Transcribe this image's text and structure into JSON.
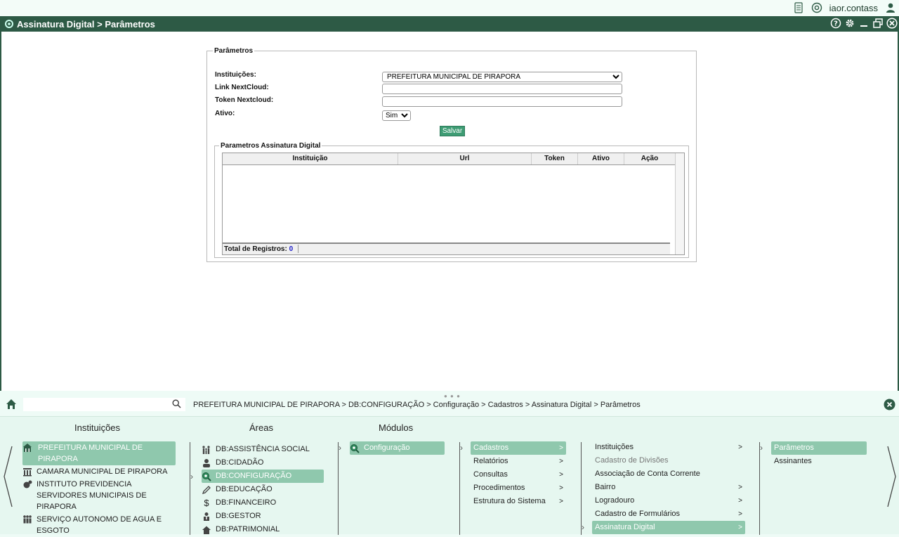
{
  "topbar": {
    "user": "iaor.contass",
    "icons": [
      "document-icon",
      "support-icon",
      "user-icon"
    ]
  },
  "window": {
    "title": "Assinatura Digital > Parâmetros",
    "tools": [
      "help-icon",
      "gear-icon",
      "minimize-icon",
      "restore-icon",
      "close-icon"
    ]
  },
  "form": {
    "legend": "Parâmetros",
    "labels": {
      "instituicoes": "Instituições:",
      "link": "Link NextCloud:",
      "token": "Token Nextcloud:",
      "ativo": "Ativo:"
    },
    "instituicao_value": "PREFEITURA MUNICIPAL DE PIRAPORA",
    "link_value": "",
    "token_value": "",
    "ativo_value": "Sim",
    "save_label": "Salvar"
  },
  "grid": {
    "legend": "Parametros Assinatura Digital",
    "columns": [
      "Instituição",
      "Url",
      "Token",
      "Ativo",
      "Ação"
    ],
    "rows": [],
    "total_label": "Total de Registros:",
    "total_value": "0"
  },
  "nav": {
    "search_value": "",
    "breadcrumb": "PREFEITURA MUNICIPAL DE PIRAPORA > DB:CONFIGURAÇÃO > Configuração > Cadastros > Assinatura Digital > Parâmetros",
    "titles": {
      "instituicoes": "Instituições",
      "areas": "Áreas",
      "modulos": "Módulos"
    },
    "instituicoes": [
      {
        "label": "PREFEITURA MUNICIPAL DE PIRAPORA",
        "icon": "building-icon"
      },
      {
        "label": "CAMARA MUNICIPAL DE PIRAPORA",
        "icon": "chamber-icon"
      },
      {
        "label": "INSTITUTO PREVIDENCIA SERVIDORES MUNICIPAIS DE PIRAPORA",
        "icon": "institute-icon"
      },
      {
        "label": "SERVIÇO AUTONOMO DE AGUA E ESGOTO",
        "icon": "people-icon"
      }
    ],
    "areas": [
      {
        "label": "DB:ASSISTÊNCIA SOCIAL",
        "icon": "family-icon"
      },
      {
        "label": "DB:CIDADÃO",
        "icon": "citizen-icon"
      },
      {
        "label": "DB:CONFIGURAÇÃO",
        "icon": "config-icon"
      },
      {
        "label": "DB:EDUCAÇÃO",
        "icon": "pencil-icon"
      },
      {
        "label": "DB:FINANCEIRO",
        "icon": "dollar-icon"
      },
      {
        "label": "DB:GESTOR",
        "icon": "manager-icon"
      },
      {
        "label": "DB:PATRIMONIAL",
        "icon": "house-icon"
      }
    ],
    "modulos": [
      {
        "label": "Configuração",
        "icon": "config-icon"
      }
    ],
    "menu1": [
      {
        "label": "Cadastros",
        "arrow": ">"
      },
      {
        "label": "Relatórios",
        "arrow": ">"
      },
      {
        "label": "Consultas",
        "arrow": ">"
      },
      {
        "label": "Procedimentos",
        "arrow": ">"
      },
      {
        "label": "Estrutura do Sistema",
        "arrow": ">"
      }
    ],
    "menu2": [
      {
        "label": "Instituições",
        "arrow": ">"
      },
      {
        "label": "Cadastro de Divisões",
        "arrow": ""
      },
      {
        "label": "Associação de Conta Corrente",
        "arrow": ""
      },
      {
        "label": "Bairro",
        "arrow": ">"
      },
      {
        "label": "Logradouro",
        "arrow": ">"
      },
      {
        "label": "Cadastro de Formulários",
        "arrow": ">"
      },
      {
        "label": "Assinatura Digital",
        "arrow": ">"
      }
    ],
    "menu3": [
      {
        "label": "Parâmetros"
      },
      {
        "label": "Assinantes"
      }
    ]
  }
}
